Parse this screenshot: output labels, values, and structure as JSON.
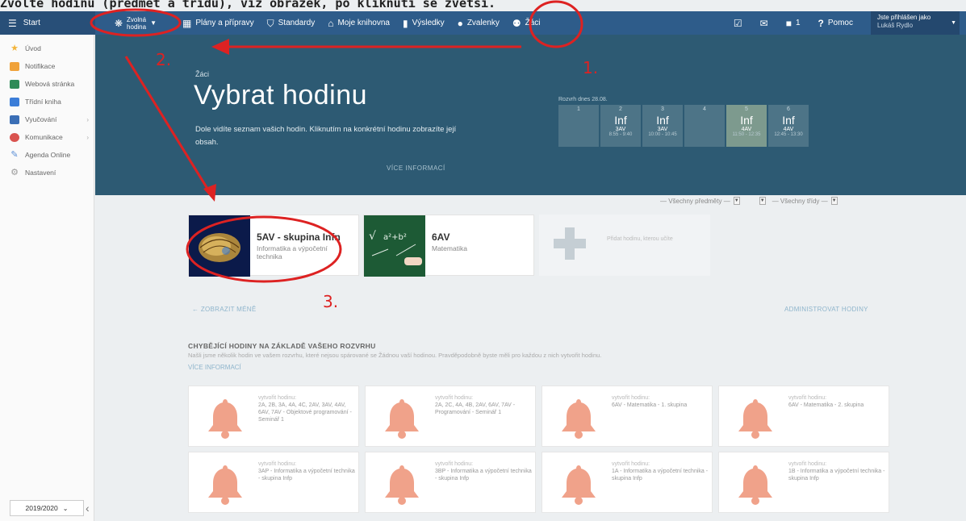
{
  "caption": "Zvolte hodinu (předmět a třídu), viz obrázek, po kliknutí se zvětší.",
  "topbar": {
    "start": "Start",
    "lesson_line1": "Zvolná",
    "lesson_line2": "hodina",
    "items": [
      {
        "label": "Plány a přípravy",
        "icon": "calendar-icon"
      },
      {
        "label": "Standardy",
        "icon": "shield-icon"
      },
      {
        "label": "Moje knihovna",
        "icon": "library-icon"
      },
      {
        "label": "Výsledky",
        "icon": "bar-chart-icon"
      },
      {
        "label": "Zvalenky",
        "icon": "badge-icon"
      },
      {
        "label": "Žáci",
        "icon": "students-icon"
      }
    ],
    "mail_count": "1",
    "help": "Pomoc",
    "user_line1": "Jste přihlášen jako",
    "user_line2": "Lukáš Rydlo"
  },
  "sidebar": {
    "items": [
      {
        "label": "Úvod",
        "icon": "star-icon",
        "color": "#f3b43a",
        "chevron": false
      },
      {
        "label": "Notifikace",
        "icon": "mail-icon",
        "color": "#f0a23a",
        "chevron": false
      },
      {
        "label": "Webová stránka",
        "icon": "home-icon",
        "color": "#2e8b57",
        "chevron": false
      },
      {
        "label": "Třídní kniha",
        "icon": "book-icon",
        "color": "#3b7dd8",
        "chevron": false
      },
      {
        "label": "Vyučování",
        "icon": "briefcase-icon",
        "color": "#3b6fb6",
        "chevron": true
      },
      {
        "label": "Komunikace",
        "icon": "people-icon",
        "color": "#d9534f",
        "chevron": true
      },
      {
        "label": "Agenda Online",
        "icon": "pencil-icon",
        "color": "#5b8fd6",
        "chevron": false
      },
      {
        "label": "Nastavení",
        "icon": "gear-icon",
        "color": "#999999",
        "chevron": false
      }
    ],
    "year": "2019/2020"
  },
  "hero": {
    "crumb": "Žáci",
    "title": "Vybrat hodinu",
    "desc": "Dole vidíte seznam vašich hodin. Kliknutím na konkrétní hodinu zobrazíte její obsah.",
    "more": "VÍCE INFORMACÍ",
    "schedule_title": "Rozvrh dnes 28.08.",
    "slots": [
      {
        "num": "1",
        "subj": "",
        "cls": "",
        "time": "",
        "active": false
      },
      {
        "num": "2",
        "subj": "Inf",
        "cls": "3AV",
        "time": "8:55 - 9:40",
        "active": false
      },
      {
        "num": "3",
        "subj": "Inf",
        "cls": "3AV",
        "time": "10:00 - 10:45",
        "active": false
      },
      {
        "num": "4",
        "subj": "",
        "cls": "",
        "time": "",
        "active": false
      },
      {
        "num": "5",
        "subj": "Inf",
        "cls": "4AV",
        "time": "11:50 - 12:35",
        "active": true
      },
      {
        "num": "6",
        "subj": "Inf",
        "cls": "4AV",
        "time": "12:45 - 13:30",
        "active": false
      }
    ]
  },
  "filters": {
    "subjects": "— Všechny předměty —",
    "classes": "— Všechny třídy —"
  },
  "cards": [
    {
      "title": "5AV - skupina Infn",
      "subtitle": "Informatika a výpočetní technika"
    },
    {
      "title": "6AV",
      "subtitle": "Matematika"
    }
  ],
  "add_card_hint": "Přidat hodinu, kterou učíte",
  "link_less": "← ZOBRAZIT MÉNĚ",
  "link_admin": "ADMINISTROVAT HODINY",
  "missing": {
    "title": "CHYBĚJÍCÍ HODINY NA ZÁKLADĚ VAŠEHO ROZVRHU",
    "desc": "Našli jsme několik hodin ve vašem rozvrhu, které nejsou spárované se Žádnou vaší hodinou. Pravděpodobně byste měli pro každou z nich vytvořit hodinu.",
    "more": "VÍCE INFORMACÍ",
    "label": "vytvořit hodinu:",
    "items": [
      "2A, 2B, 3A, 4A, 4C, 2AV, 3AV, 4AV, 6AV, 7AV - Objektové programování - Seminář 1",
      "2A, 2C, 4A, 4B, 2AV, 6AV, 7AV - Programování - Seminář 1",
      "6AV - Matematika - 1. skupina",
      "6AV - Matematika - 2. skupina",
      "3AP - Informatika a výpočetní technika - skupina Infp",
      "3BP - Informatika a výpočetní technika - skupina Infp",
      "1A - Informatika a výpočetní technika - skupina Infp",
      "1B - Informatika a výpočetní technika - skupina Infp"
    ]
  },
  "annotations": [
    "1.",
    "2.",
    "3."
  ],
  "colors": {
    "annotation": "#dd2222",
    "bell": "#f0a28a",
    "hero": "#2d5a73",
    "topbar": "#2e5c8a"
  }
}
